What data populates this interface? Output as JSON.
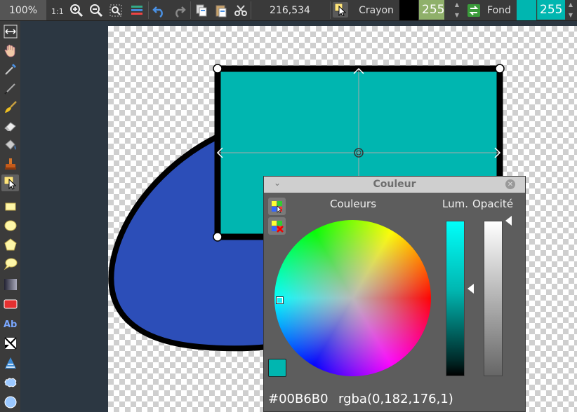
{
  "toolbar": {
    "zoom": "100%",
    "cursor_coords": "216,534",
    "pen_label": "Crayon",
    "pen_color": "#000000",
    "pen_alpha": "255",
    "fill_label": "Fond",
    "fill_color": "#00b6b0",
    "fill_alpha": "255",
    "icons": [
      "actual-size-icon",
      "zoom-in-icon",
      "zoom-out-icon",
      "zoom-fit-icon",
      "layers-icon",
      "undo-icon",
      "redo-icon",
      "copy-icon",
      "paste-icon",
      "cut-icon",
      "select-tool-icon",
      "swap-colors-icon"
    ]
  },
  "tools": [
    "move-view-icon",
    "hand-icon",
    "color-picker-icon",
    "pen-icon",
    "brush-icon",
    "eraser-icon",
    "fill-bucket-icon",
    "clone-stamp-icon",
    "select-arrow-icon",
    "rectangle-icon",
    "ellipse-icon",
    "polygon-icon",
    "speech-bubble-icon",
    "gradient-icon",
    "rounded-rect-icon",
    "text-icon",
    "deform-icon",
    "pattern-icon",
    "cloud-icon",
    "circle-icon"
  ],
  "canvas": {
    "rect_fill": "#00b6b0",
    "blob_fill": "#2c4eb8",
    "stroke": "#000000"
  },
  "color_panel": {
    "title": "Couleur",
    "colors_label": "Couleurs",
    "lum_label": "Lum.",
    "opacity_label": "Opacité",
    "hex_value": "#00B6B0",
    "rgba_value": "rgba(0,182,176,1)",
    "current_color": "#00b6b0"
  }
}
